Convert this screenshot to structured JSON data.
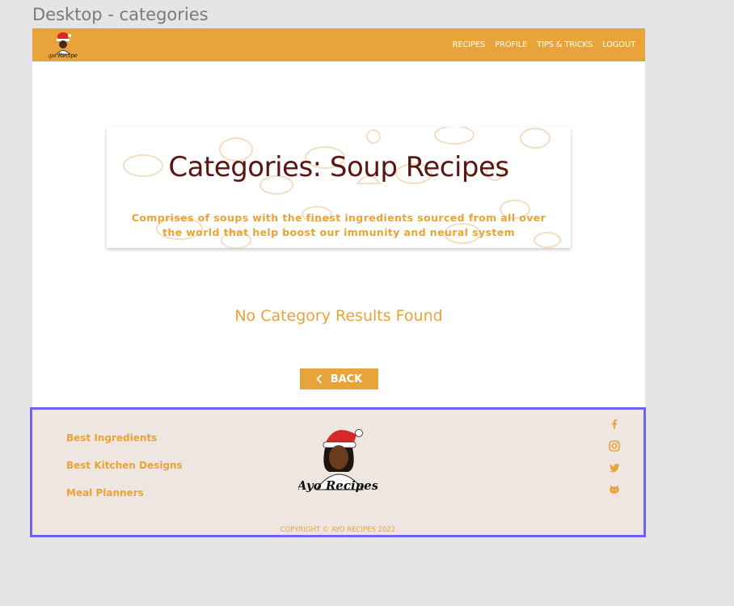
{
  "frame": {
    "label": "Desktop - categories"
  },
  "nav": {
    "logo_text": "Ayo Recipes",
    "links": [
      "RECIPES",
      "PROFILE",
      "TIPS & TRICKS",
      "LOGOUT"
    ]
  },
  "hero": {
    "title": "Categories: Soup Recipes",
    "subtitle": "Comprises of soups with the finest ingredients sourced from all over the world that help boost our immunity and neural system"
  },
  "main": {
    "empty_message": "No Category Results Found",
    "back_label": "BACK",
    "back_icon": "chevron-left-icon"
  },
  "footer": {
    "links": [
      "Best Ingredients",
      "Best Kitchen Designs",
      "Meal Planners"
    ],
    "logo_text": "Ayo Recipes",
    "social_icons": [
      "facebook-icon",
      "instagram-icon",
      "twitter-icon",
      "github-icon"
    ],
    "copyright": "COPYRIGHT © AYO RECIPES 2022"
  },
  "colors": {
    "accent": "#e8a43a",
    "title": "#5a1511",
    "footer_bg": "#efe6e1",
    "selection_outline": "#6d63f2"
  }
}
